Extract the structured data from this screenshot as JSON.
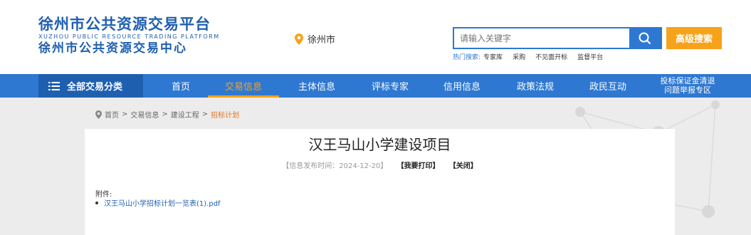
{
  "header": {
    "logo_line1": "徐州市公共资源交易平台",
    "logo_en": "XUZHOU PUBLIC RESOURCE TRADING PLATFORM",
    "logo_line2": "徐州市公共资源交易中心",
    "location": "徐州市",
    "search_placeholder": "请输入关键字",
    "advanced_search": "高级搜索",
    "hot_label": "热门搜索:",
    "hot_terms": [
      "专家库",
      "采购",
      "不见面开标",
      "监督平台"
    ]
  },
  "nav": {
    "all_categories": "全部交易分类",
    "items": [
      "首页",
      "交易信息",
      "主体信息",
      "评标专家",
      "信用信息",
      "政策法规",
      "政民互动"
    ],
    "active_index": 1,
    "extra_line1": "投标保证金清退",
    "extra_line2": "问题举报专区"
  },
  "breadcrumb": [
    "首页",
    "交易信息",
    "建设工程",
    "招标计划"
  ],
  "article": {
    "title": "汉王马山小学建设项目",
    "meta_prefix": "【信息发布时间：",
    "date": "2024-12-20",
    "meta_suffix": "】",
    "print": "【我要打印】",
    "close": "【关闭】",
    "attachment_label": "附件:",
    "attachment_file": "汉王马山小学招标计划一览表(1).pdf"
  },
  "colors": {
    "brand_blue": "#2e78d2",
    "dark_blue": "#1f5fb0",
    "accent_orange": "#f7a21b"
  }
}
